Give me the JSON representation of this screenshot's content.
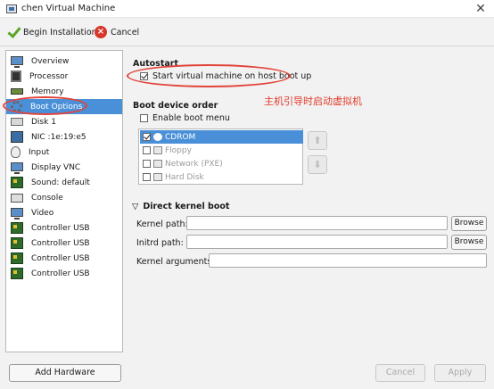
{
  "window": {
    "title": "chen Virtual Machine",
    "close_glyph": "✕"
  },
  "toolbar": {
    "install_label": "Begin Installation",
    "cancel_label": "Cancel"
  },
  "sidebar": {
    "items": [
      {
        "label": "Overview",
        "icon": "monitor-icon"
      },
      {
        "label": "Processor",
        "icon": "cpu-icon"
      },
      {
        "label": "Memory",
        "icon": "memory-icon"
      },
      {
        "label": "Boot Options",
        "icon": "boot-gear-icon",
        "selected": true
      },
      {
        "label": "Disk 1",
        "icon": "disk-icon"
      },
      {
        "label": "NIC :1e:19:e5",
        "icon": "nic-icon"
      },
      {
        "label": "Input",
        "icon": "mouse-icon"
      },
      {
        "label": "Display VNC",
        "icon": "display-icon"
      },
      {
        "label": "Sound: default",
        "icon": "sound-card-icon"
      },
      {
        "label": "Console",
        "icon": "console-icon"
      },
      {
        "label": "Video",
        "icon": "video-icon"
      },
      {
        "label": "Controller USB",
        "icon": "controller-icon"
      },
      {
        "label": "Controller USB",
        "icon": "controller-icon"
      },
      {
        "label": "Controller USB",
        "icon": "controller-icon"
      },
      {
        "label": "Controller USB",
        "icon": "controller-icon"
      }
    ],
    "add_hardware_label": "Add Hardware"
  },
  "autostart": {
    "title": "Autostart",
    "checkbox_label": "Start virtual machine on host boot up",
    "checked": true
  },
  "annotation": {
    "text": "主机引导时启动虚拟机",
    "color": "#e23a2a"
  },
  "boot_order": {
    "title": "Boot device order",
    "enable_menu_label": "Enable boot menu",
    "enable_menu_checked": false,
    "devices": [
      {
        "label": "CDROM",
        "checked": true,
        "selected": true
      },
      {
        "label": "Floppy",
        "checked": false
      },
      {
        "label": "Network (PXE)",
        "checked": false
      },
      {
        "label": "Hard Disk",
        "checked": false
      }
    ],
    "up_glyph": "⬆",
    "down_glyph": "⬇"
  },
  "kernel_boot": {
    "title": "Direct kernel boot",
    "expander_glyph": "▽",
    "kernel_path_label": "Kernel path:",
    "kernel_path_value": "",
    "initrd_path_label": "Initrd path:",
    "initrd_path_value": "",
    "kernel_args_label": "Kernel arguments:",
    "kernel_args_value": "",
    "browse_label": "Browse"
  },
  "footer": {
    "cancel_label": "Cancel",
    "apply_label": "Apply"
  },
  "colors": {
    "selection": "#4a90d9",
    "annotation_red": "#e2433a"
  }
}
